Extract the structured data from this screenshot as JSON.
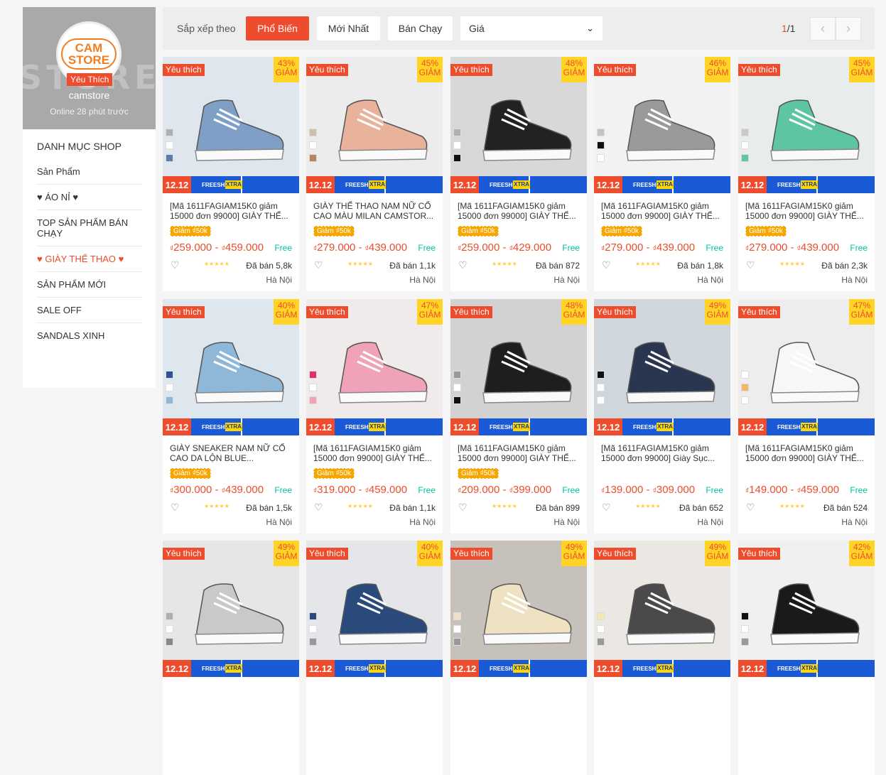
{
  "shop": {
    "logo_text": "CAM\nSTORE",
    "bg_text": "STORE",
    "badge": "Yêu Thích",
    "name": "camstore",
    "online": "Online 28 phút trước"
  },
  "sidebar": {
    "title": "DANH MỤC SHOP",
    "items": [
      {
        "label": "Sản Phẩm",
        "active": false
      },
      {
        "label": "♥ ÁO NỈ ♥",
        "active": false
      },
      {
        "label": "TOP SẢN PHẨM BÁN CHẠY",
        "active": false
      },
      {
        "label": "♥ GIÀY THỂ THAO ♥",
        "active": true
      },
      {
        "label": "SẢN PHẨM MỚI",
        "active": false
      },
      {
        "label": "SALE OFF",
        "active": false
      },
      {
        "label": "SANDALS XINH",
        "active": false
      }
    ]
  },
  "sort": {
    "label": "Sắp xếp theo",
    "buttons": [
      "Phổ Biến",
      "Mới Nhất",
      "Bán Chạy"
    ],
    "price_label": "Giá",
    "page_current": "1",
    "page_total": "/1"
  },
  "products": [
    {
      "fav": "Yêu thích",
      "pct": "43%",
      "off": "GIẢM",
      "name": "[Mã 1611FAGIAM15K0 giảm 15000 đơn 99000] GIÀY THỂ...",
      "voucher": "Giảm ₫50k",
      "price_lo": "259.000",
      "price_hi": "459.000",
      "sold": "Đã bán 5,8k",
      "loc": "Hà Nội",
      "bg": "#dfe6ee",
      "shoe": "#7f9fc7",
      "sw": [
        "#b0b0b0",
        "#ffffff",
        "#5b7ea8"
      ]
    },
    {
      "fav": "Yêu thích",
      "pct": "45%",
      "off": "GIẢM",
      "name": "GIÀY THỂ THAO NAM NỮ CỔ CAO MÀU MILAN CAMSTOR...",
      "voucher": "Giảm ₫50k",
      "price_lo": "279.000",
      "price_hi": "439.000",
      "sold": "Đã bán 1,1k",
      "loc": "Hà Nội",
      "bg": "#ececec",
      "shoe": "#e9b29a",
      "sw": [
        "#cdbfae",
        "#ffffff",
        "#b88561"
      ]
    },
    {
      "fav": "Yêu thích",
      "pct": "48%",
      "off": "GIẢM",
      "name": "[Mã 1611FAGIAM15K0 giảm 15000 đơn 99000] GIÀY THỂ...",
      "voucher": "Giảm ₫50k",
      "price_lo": "259.000",
      "price_hi": "429.000",
      "sold": "Đã bán 872",
      "loc": "Hà Nội",
      "bg": "#d8d8d8",
      "shoe": "#222222",
      "sw": [
        "#b0b0b0",
        "#ffffff",
        "#111111"
      ]
    },
    {
      "fav": "Yêu thích",
      "pct": "46%",
      "off": "GIẢM",
      "name": "[Mã 1611FAGIAM15K0 giảm 15000 đơn 99000] GIÀY THỂ...",
      "voucher": "Giảm ₫50k",
      "price_lo": "279.000",
      "price_hi": "439.000",
      "sold": "Đã bán 1,8k",
      "loc": "Hà Nội",
      "bg": "#f2f2f2",
      "shoe": "#9a9a9a",
      "sw": [
        "#c4c4c4",
        "#111111",
        "#ffffff"
      ]
    },
    {
      "fav": "Yêu thích",
      "pct": "45%",
      "off": "GIẢM",
      "name": "[Mã 1611FAGIAM15K0 giảm 15000 đơn 99000] GIÀY THỂ...",
      "voucher": "Giảm ₫50k",
      "price_lo": "279.000",
      "price_hi": "439.000",
      "sold": "Đã bán 2,3k",
      "loc": "Hà Nội",
      "bg": "#e8ecea",
      "shoe": "#5ec5a3",
      "sw": [
        "#c8c8c8",
        "#ffffff",
        "#5ec5a3"
      ]
    },
    {
      "fav": "Yêu thích",
      "pct": "40%",
      "off": "GIẢM",
      "name": "GIÀY SNEAKER NAM NỮ CỔ CAO DA LỘN BLUE...",
      "voucher": "Giảm ₫50k",
      "price_lo": "300.000",
      "price_hi": "439.000",
      "sold": "Đã bán 1,5k",
      "loc": "Hà Nội",
      "bg": "#dfe7ee",
      "shoe": "#8fb8d8",
      "sw": [
        "#2d4fa0",
        "#ffffff",
        "#8fb8d8"
      ]
    },
    {
      "fav": "Yêu thích",
      "pct": "47%",
      "off": "GIẢM",
      "name": "[Mã 1611FAGIAM15K0 giảm 15000 đơn 99000] GIÀY THỂ...",
      "voucher": "Giảm ₫50k",
      "price_lo": "319.000",
      "price_hi": "459.000",
      "sold": "Đã bán 1,1k",
      "loc": "Hà Nội",
      "bg": "#f1eaea",
      "shoe": "#f0a3b8",
      "sw": [
        "#e0306a",
        "#ffffff",
        "#f0a3b8"
      ]
    },
    {
      "fav": "Yêu thích",
      "pct": "48%",
      "off": "GIẢM",
      "name": "[Mã 1611FAGIAM15K0 giảm 15000 đơn 99000] GIÀY THỂ...",
      "voucher": "Giảm ₫50k",
      "price_lo": "209.000",
      "price_hi": "399.000",
      "sold": "Đã bán 899",
      "loc": "Hà Nội",
      "bg": "#d2d2d2",
      "shoe": "#1e1e1e",
      "sw": [
        "#999999",
        "#ffffff",
        "#111111"
      ]
    },
    {
      "fav": "Yêu thích",
      "pct": "49%",
      "off": "GIẢM",
      "name": "[Mã 1611FAGIAM15K0 giảm 15000 đơn 99000] Giày Sục...",
      "voucher": "",
      "price_lo": "139.000",
      "price_hi": "309.000",
      "sold": "Đã bán 652",
      "loc": "Hà Nội",
      "bg": "#cfd6dc",
      "shoe": "#2a3550",
      "sw": [
        "#111111",
        "#ffffff",
        "#ffffff"
      ]
    },
    {
      "fav": "Yêu thích",
      "pct": "47%",
      "off": "GIẢM",
      "name": "[Mã 1611FAGIAM15K0 giảm 15000 đơn 99000] GIÀY THỂ...",
      "voucher": "",
      "price_lo": "149.000",
      "price_hi": "459.000",
      "sold": "Đã bán 524",
      "loc": "Hà Nội",
      "bg": "#ededed",
      "shoe": "#f7f7f7",
      "sw": [
        "#ffffff",
        "#f6b66a",
        "#ffffff"
      ]
    },
    {
      "fav": "Yêu thích",
      "pct": "49%",
      "off": "GIẢM",
      "name": "",
      "voucher": "",
      "price_lo": "",
      "price_hi": "",
      "sold": "",
      "loc": "",
      "bg": "#e6e6e6",
      "shoe": "#c9c9c9",
      "sw": [
        "#b0b0b0",
        "#ffffff",
        "#888888"
      ]
    },
    {
      "fav": "Yêu thích",
      "pct": "40%",
      "off": "GIẢM",
      "name": "",
      "voucher": "",
      "price_lo": "",
      "price_hi": "",
      "sold": "",
      "loc": "",
      "bg": "#e4e6ea",
      "shoe": "#2b4a7c",
      "sw": [
        "#2b4a7c",
        "#ffffff",
        "#999999"
      ]
    },
    {
      "fav": "Yêu thích",
      "pct": "49%",
      "off": "GIẢM",
      "name": "",
      "voucher": "",
      "price_lo": "",
      "price_hi": "",
      "sold": "",
      "loc": "",
      "bg": "#c7c1bb",
      "shoe": "#efe2c3",
      "sw": [
        "#efe2c3",
        "#ffffff",
        "#999999"
      ]
    },
    {
      "fav": "Yêu thích",
      "pct": "49%",
      "off": "GIẢM",
      "name": "",
      "voucher": "",
      "price_lo": "",
      "price_hi": "",
      "sold": "",
      "loc": "",
      "bg": "#ebe8e4",
      "shoe": "#4a4a4a",
      "sw": [
        "#f3e8b0",
        "#ffffff",
        "#999999"
      ]
    },
    {
      "fav": "Yêu thích",
      "pct": "42%",
      "off": "GIẢM",
      "name": "",
      "voucher": "",
      "price_lo": "",
      "price_hi": "",
      "sold": "",
      "loc": "",
      "bg": "#f0f0f0",
      "shoe": "#1a1a1a",
      "sw": [
        "#111111",
        "#ffffff",
        "#999999"
      ]
    }
  ],
  "banner": {
    "date": "12.12",
    "freeship": "FREESHIP",
    "xtra": "XTRA"
  },
  "currency": "₫",
  "ship_icon": "Free",
  "stars": "★★★★★",
  "heart_icon": "♡",
  "prev_icon": "‹",
  "next_icon": "›",
  "chevron_icon": "⌄"
}
